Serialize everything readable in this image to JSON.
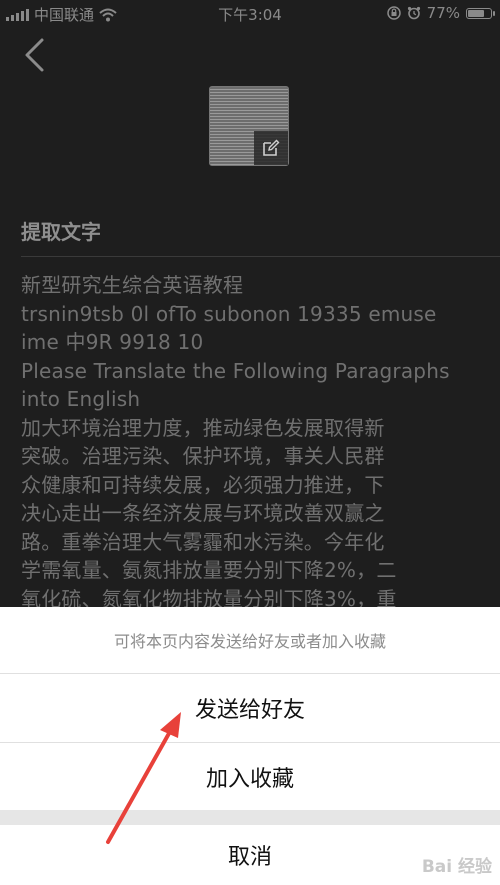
{
  "status_bar": {
    "carrier": "中国联通",
    "time": "下午3:04",
    "battery": "77%",
    "battery_level": 0.77
  },
  "header": {
    "section_title": "提取文字"
  },
  "extracted_text": {
    "lines": [
      "新型研究生综合英语教程",
      "  trsnin9tsb 0l ofTo subonon 19335 emuse",
      "ime 中9R 9918 10",
      "Please Translate the Following Paragraphs",
      "into English",
      "  加大环境治理力度，推动绿色发展取得新",
      "突破。治理污染、保护环境，事关人民群",
      "众健康和可持续发展，必须强力推进，下",
      "决心走出一条经济发展与环境改善双赢之",
      "路。重拳治理大气雾霾和水污染。今年化",
      "学需氧量、氨氮排放量要分别下降2%，二",
      "氧化硫、氮氧化物排放量分别下降3%，重"
    ]
  },
  "action_sheet": {
    "hint": "可将本页内容发送给好友或者加入收藏",
    "send_label": "发送给好友",
    "favorite_label": "加入收藏",
    "cancel_label": "取消"
  },
  "watermark": {
    "text": "Bai 经验"
  },
  "colors": {
    "background": "#1e1e1e",
    "sheet": "#ffffff",
    "arrow": "#e8413a"
  },
  "icons": [
    "wifi-icon",
    "back-chevron-icon",
    "edit-icon",
    "orientation-lock-icon",
    "alarm-icon",
    "battery-icon"
  ]
}
